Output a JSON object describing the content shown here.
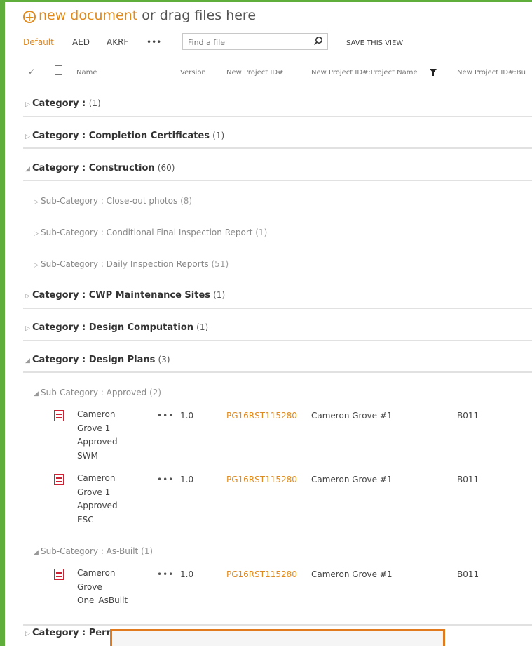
{
  "header": {
    "new_document": "new document",
    "or_drag": " or drag files here"
  },
  "views": [
    "Default",
    "AED",
    "AKRF",
    "•••"
  ],
  "search": {
    "placeholder": "Find a file"
  },
  "save_view": "SAVE THIS VIEW",
  "columns": [
    "Name",
    "Version",
    "New Project ID#",
    "New Project ID#:Project Name",
    "New Project ID#:Bu"
  ],
  "groups": [
    {
      "label": "Category : ",
      "name": "",
      "count": "(1)"
    },
    {
      "label": "Category : ",
      "name": "Completion Certificates",
      "count": "(1)"
    },
    {
      "label": "Category : ",
      "name": "Construction",
      "count": "(60)"
    },
    {
      "label": "Sub-Category : ",
      "name": "Close-out photos",
      "count": "(8)"
    },
    {
      "label": "Sub-Category : ",
      "name": "Conditional Final Inspection Report",
      "count": "(1)"
    },
    {
      "label": "Sub-Category : ",
      "name": "Daily Inspection Reports",
      "count": "(51)"
    },
    {
      "label": "Category : ",
      "name": "CWP Maintenance Sites",
      "count": "(1)"
    },
    {
      "label": "Category : ",
      "name": "Design Computation",
      "count": "(1)"
    },
    {
      "label": "Category : ",
      "name": "Design Plans",
      "count": "(3)"
    },
    {
      "label": "Sub-Category : ",
      "name": "Approved",
      "count": "(2)"
    },
    {
      "label": "Sub-Category : ",
      "name": "As-Built",
      "count": "(1)"
    },
    {
      "label": "Category : ",
      "name": "Perm",
      "count": ""
    }
  ],
  "files": [
    {
      "name": "Cameron Grove 1 Approved SWM",
      "dots": "•••",
      "version": "1.0",
      "project_id": "PG16RST115280",
      "project_name": "Cameron Grove #1",
      "bu": "B011"
    },
    {
      "name": "Cameron Grove 1 Approved ESC",
      "dots": "•••",
      "version": "1.0",
      "project_id": "PG16RST115280",
      "project_name": "Cameron Grove #1",
      "bu": "B011"
    },
    {
      "name": "Cameron Grove One_AsBuilt",
      "dots": "•••",
      "version": "1.0",
      "project_id": "PG16RST115280",
      "project_name": "Cameron Grove #1",
      "bu": "B011"
    }
  ],
  "colors": {
    "accent": "#e08a1e",
    "frame": "#5fae3c",
    "popup_border": "#e07a1c"
  }
}
